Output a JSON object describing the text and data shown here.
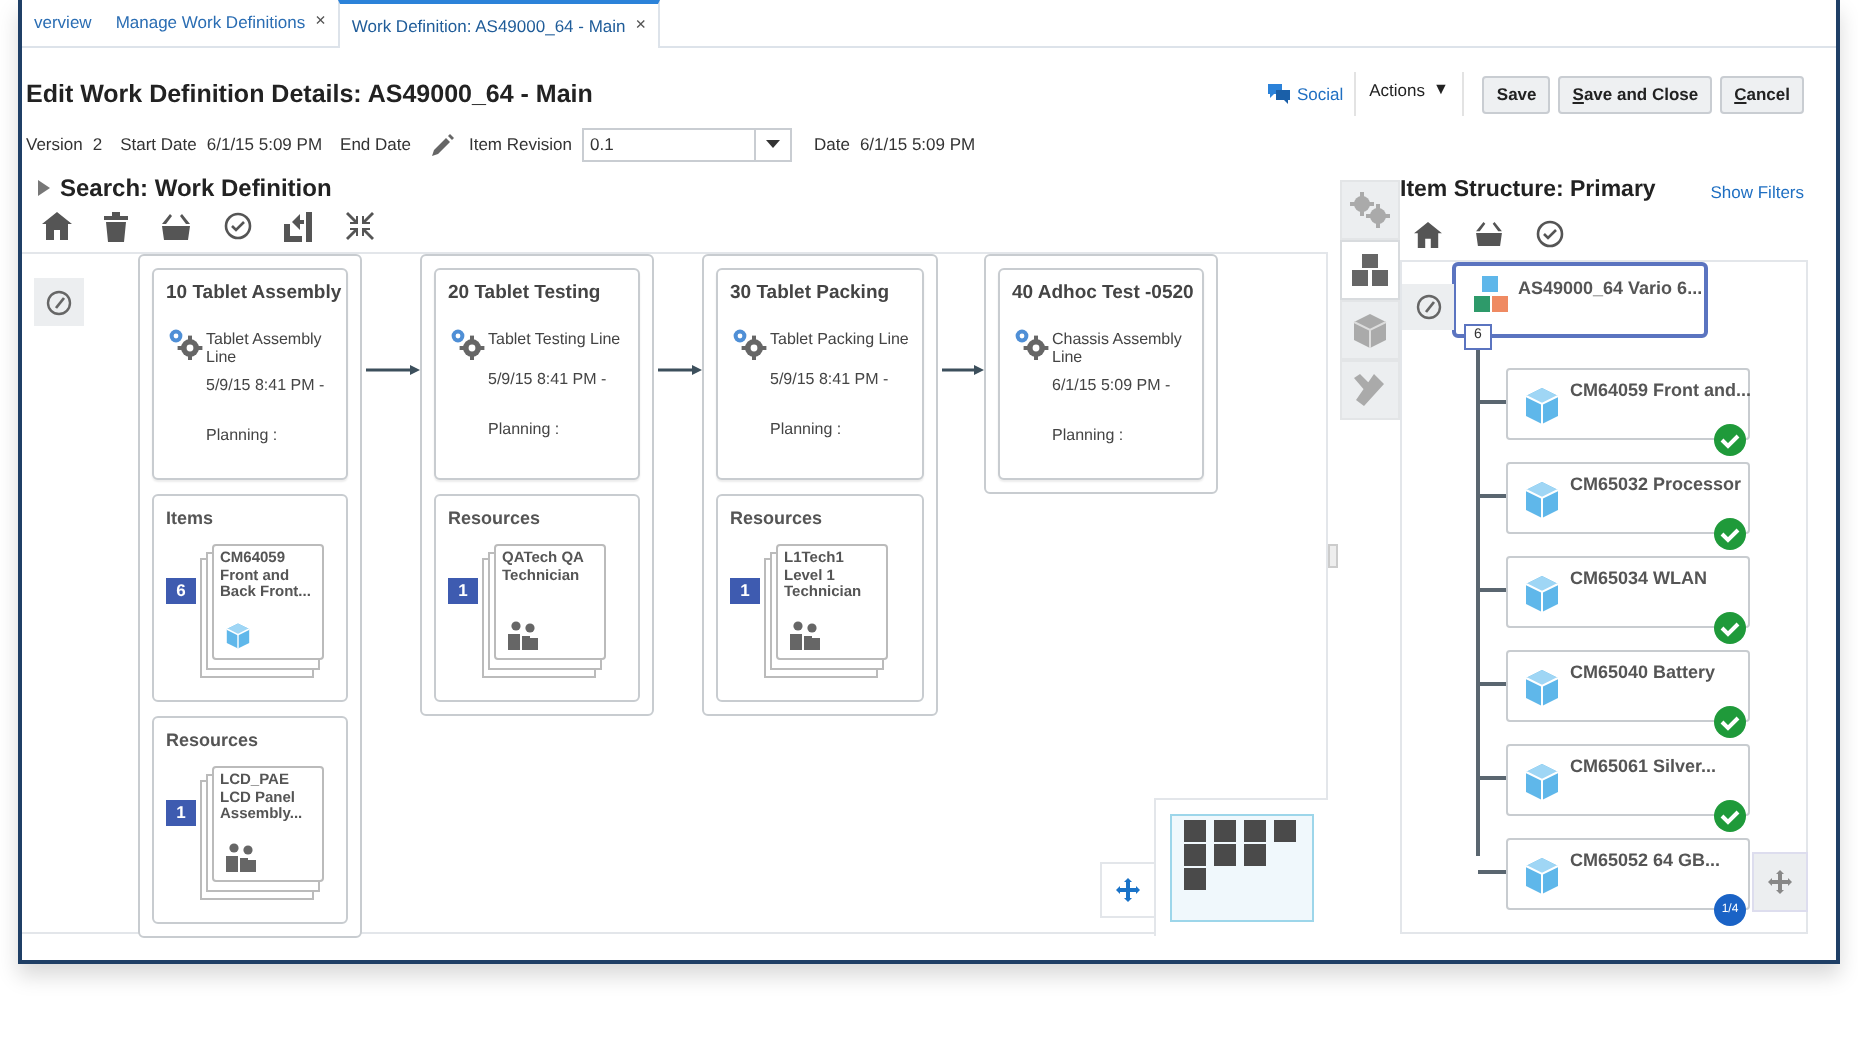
{
  "tabs": [
    {
      "label": "verview",
      "selected": false
    },
    {
      "label": "Manage Work Definitions",
      "close": "×",
      "selected": false
    },
    {
      "label": "Work Definition: AS49000_64 - Main",
      "close": "×",
      "selected": true
    }
  ],
  "page_title": "Edit Work Definition Details: AS49000_64 - Main",
  "header_actions": {
    "social": "Social",
    "actions": "Actions",
    "actions_caret": "▼",
    "buttons": [
      {
        "label": "Save",
        "mnemonic": false
      },
      {
        "label": "Save and Close",
        "mnemonic": true
      },
      {
        "label": "Cancel",
        "mnemonic": true
      }
    ]
  },
  "info": {
    "fields": [
      {
        "label": "Version",
        "value": "2"
      },
      {
        "label": "Start Date",
        "value": "6/1/15 5:09 PM"
      },
      {
        "label": "End Date"
      }
    ],
    "item_revision_label": "Item Revision",
    "item_revision_value": "0.1",
    "date_label": "Date",
    "date_value": "6/1/15 5:09 PM"
  },
  "search": {
    "label": "Search: Work Definition",
    "expanded": false
  },
  "operations": [
    {
      "title": "10 Tablet Assembly",
      "line": "Tablet Assembly Line",
      "date": "5/9/15 8:41 PM -",
      "planning": "Planning :",
      "sections": [
        {
          "heading": "Items",
          "count": "6",
          "text": "CM64059 Front and Back Front...",
          "kind": "item"
        },
        {
          "heading": "Resources",
          "count": "1",
          "text": "LCD_PAE LCD Panel Assembly...",
          "kind": "resource"
        }
      ]
    },
    {
      "title": "20 Tablet Testing",
      "line": "Tablet Testing Line",
      "date": "5/9/15 8:41 PM -",
      "planning": "Planning :",
      "sections": [
        {
          "heading": "Resources",
          "count": "1",
          "text": "QATech QA Technician",
          "kind": "resource"
        }
      ]
    },
    {
      "title": "30 Tablet Packing",
      "line": "Tablet Packing Line",
      "date": "5/9/15 8:41 PM -",
      "planning": "Planning :",
      "sections": [
        {
          "heading": "Resources",
          "count": "1",
          "text": "L1Tech1 Level 1 Technician",
          "kind": "resource"
        }
      ]
    },
    {
      "title": "40 Adhoc Test -0520",
      "line": "Chassis Assembly Line",
      "date": "6/1/15 5:09 PM -",
      "planning": "Planning :"
    }
  ],
  "side_tabs": [
    {
      "selected": false
    },
    {
      "selected": true
    },
    {
      "selected": false
    },
    {
      "selected": false
    }
  ],
  "item_structure": {
    "title": "Item Structure: Primary",
    "show_filters": "Show Filters",
    "root": {
      "label": "AS49000_64 Vario 6...",
      "count": "6",
      "selected": true
    },
    "children": [
      {
        "label": "CM64059 Front and...",
        "kind": "check"
      },
      {
        "label": "CM65032 Processor",
        "kind": "check"
      },
      {
        "label": "CM65034 WLAN",
        "kind": "check"
      },
      {
        "label": "CM65040 Battery",
        "kind": "check"
      },
      {
        "label": "CM65061 Silver...",
        "kind": "check"
      },
      {
        "label": "CM65052 64 GB...",
        "kind": "badge",
        "badge": "1/4"
      }
    ]
  }
}
